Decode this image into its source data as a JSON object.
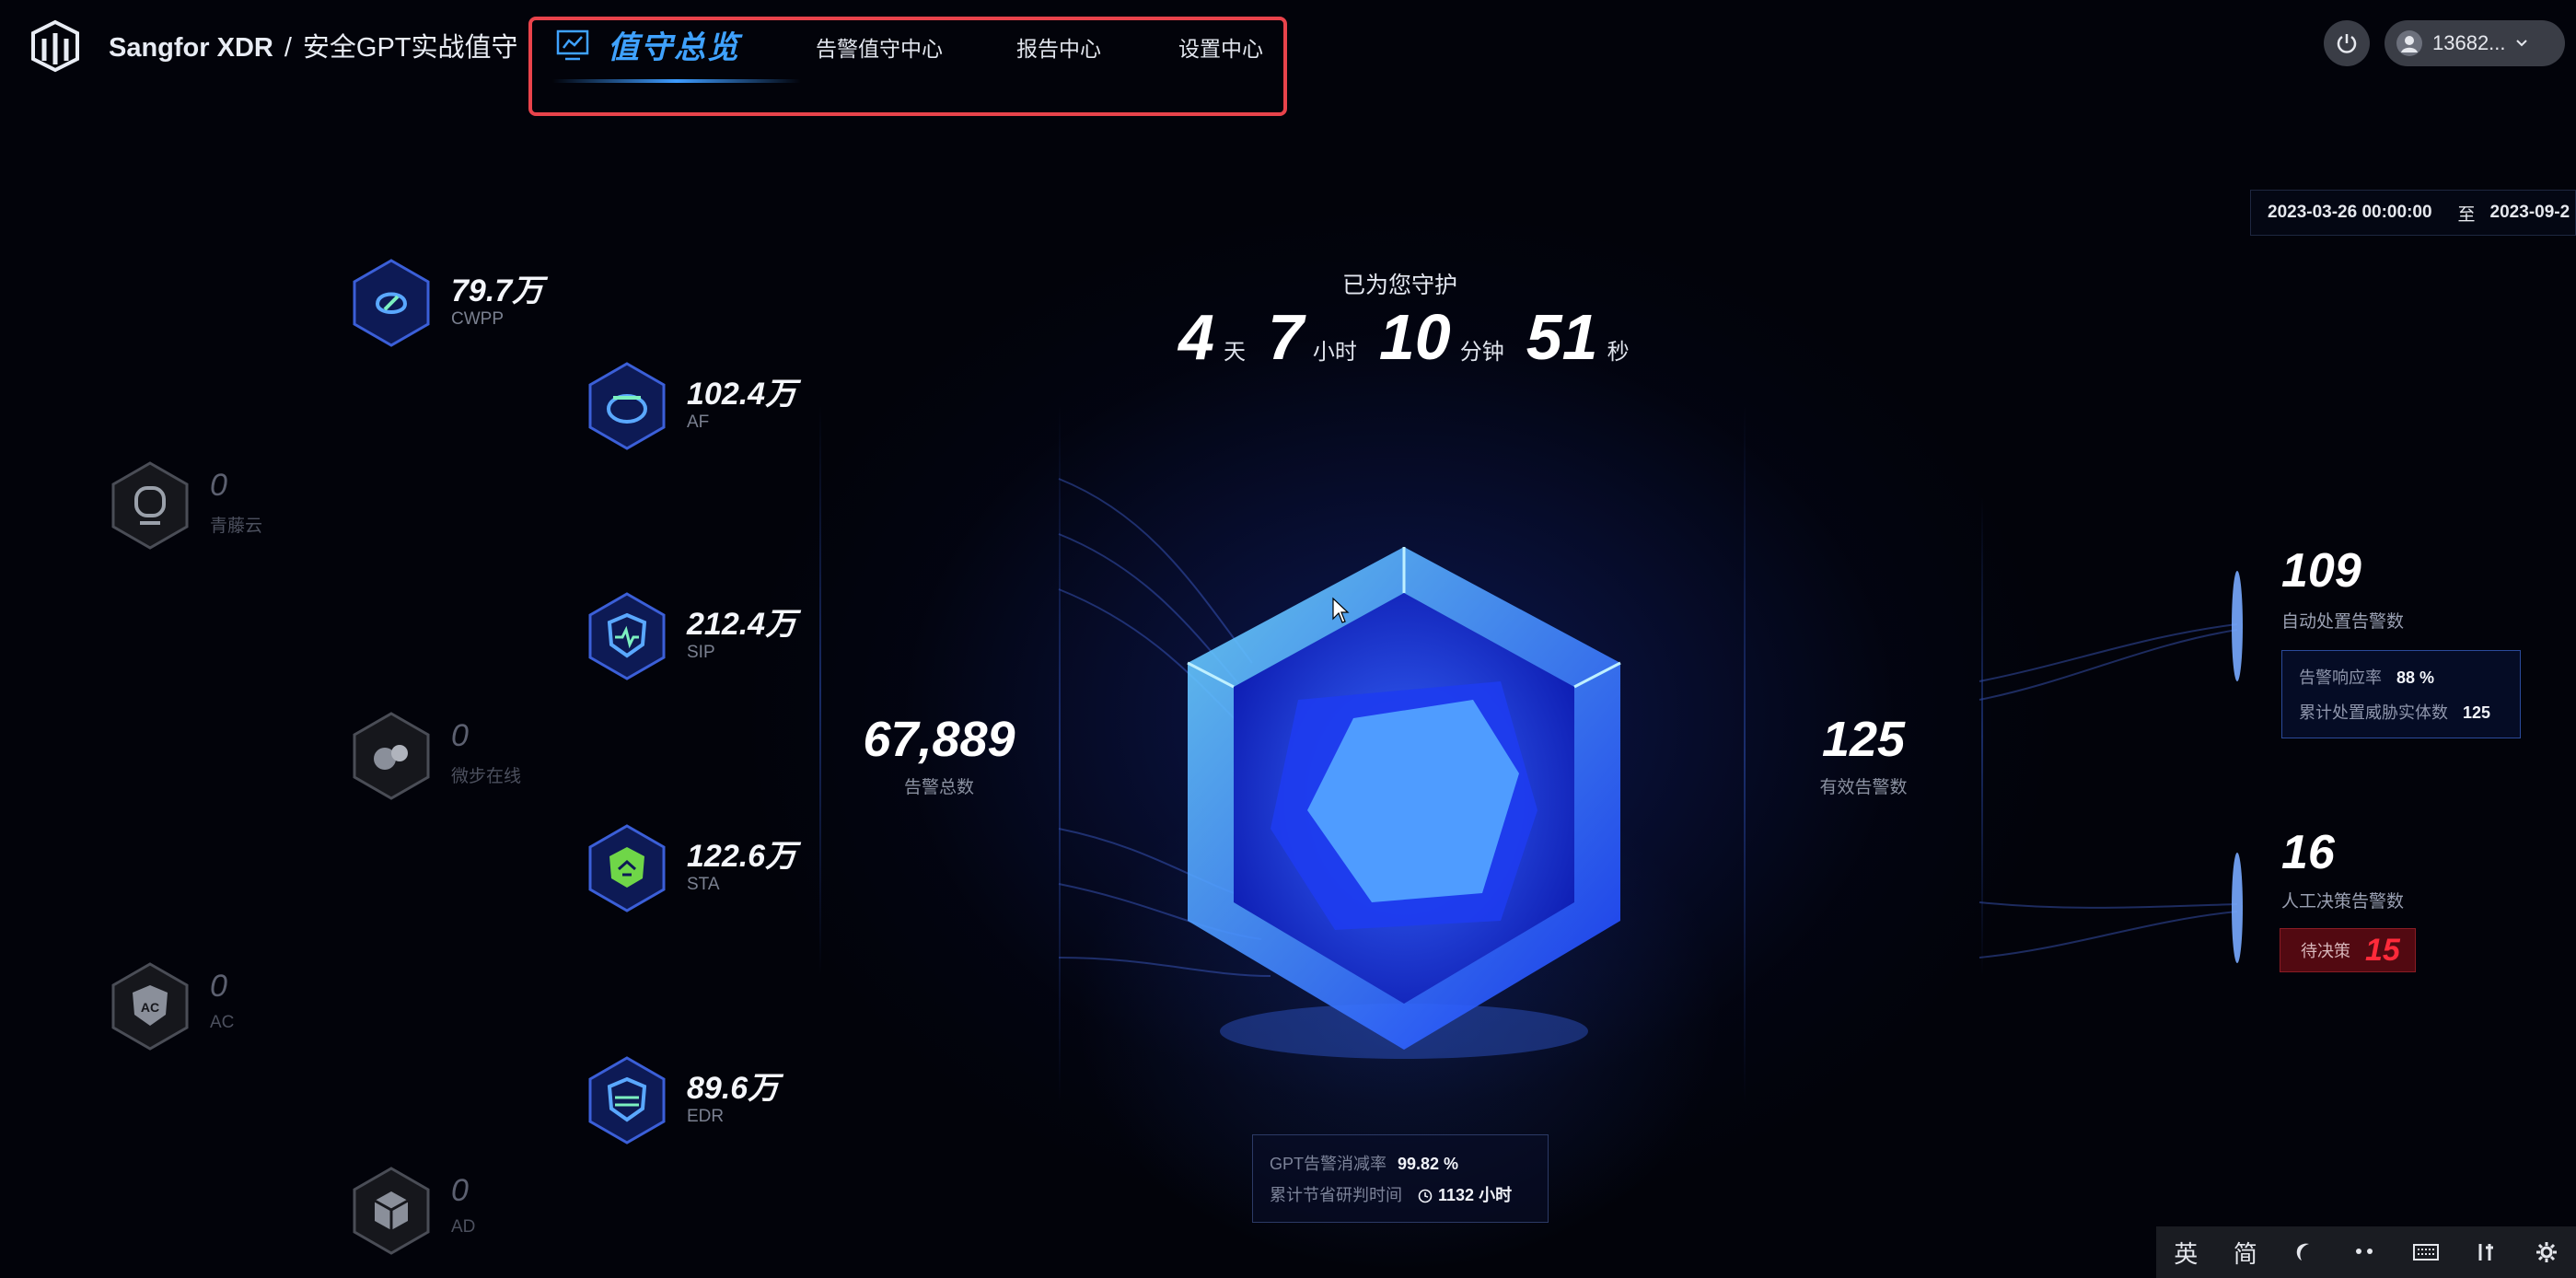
{
  "header": {
    "brand": "Sangfor XDR",
    "separator": "/",
    "subtitle": "安全GPT实战值守",
    "nav": {
      "active": "值守总览",
      "items": [
        "告警值守中心",
        "报告中心",
        "设置中心"
      ]
    },
    "user": "13682..."
  },
  "date_range": {
    "start": "2023-03-26 00:00:00",
    "to": "至",
    "end": "2023-09-2"
  },
  "devices": {
    "cwpp": {
      "value": "79.7万",
      "label": "CWPP"
    },
    "af": {
      "value": "102.4万",
      "label": "AF"
    },
    "qingteng": {
      "value": "0",
      "label": "青藤云"
    },
    "sip": {
      "value": "212.4万",
      "label": "SIP"
    },
    "weibu": {
      "value": "0",
      "label": "微步在线"
    },
    "sta": {
      "value": "122.6万",
      "label": "STA"
    },
    "ac": {
      "value": "0",
      "label": "AC"
    },
    "edr": {
      "value": "89.6万",
      "label": "EDR"
    },
    "ad": {
      "value": "0",
      "label": "AD"
    }
  },
  "guard": {
    "title": "已为您守护",
    "days": "4",
    "days_unit": "天",
    "hours": "7",
    "hours_unit": "小时",
    "minutes": "10",
    "minutes_unit": "分钟",
    "seconds": "51",
    "seconds_unit": "秒"
  },
  "total_alerts": {
    "value": "67,889",
    "label": "告警总数"
  },
  "valid_alerts": {
    "value": "125",
    "label": "有效告警数"
  },
  "gpt": {
    "rate_label": "GPT告警消减率",
    "rate_value": "99.82 %",
    "saved_label": "累计节省研判时间",
    "saved_value": "1132 小时"
  },
  "auto": {
    "value": "109",
    "label": "自动处置告警数",
    "response_label": "告警响应率",
    "response_value": "88 %",
    "entity_label": "累计处置威胁实体数",
    "entity_value": "125"
  },
  "manual": {
    "value": "16",
    "label": "人工决策告警数",
    "pending_label": "待决策",
    "pending_value": "15"
  },
  "ime": {
    "lang": "英",
    "mode": "简"
  },
  "colors": {
    "accent": "#3fa2ff",
    "highlight": "#e9434b",
    "alert": "#ff2a3a"
  }
}
